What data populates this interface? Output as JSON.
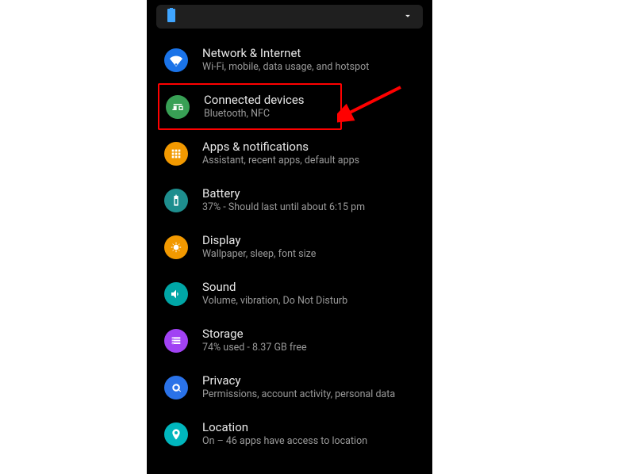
{
  "items": [
    {
      "title": "Network & Internet",
      "subtitle": "Wi-Fi, mobile, data usage, and hotspot"
    },
    {
      "title": "Connected devices",
      "subtitle": "Bluetooth, NFC"
    },
    {
      "title": "Apps & notifications",
      "subtitle": "Assistant, recent apps, default apps"
    },
    {
      "title": "Battery",
      "subtitle": "37% - Should last until about 6:15 pm"
    },
    {
      "title": "Display",
      "subtitle": "Wallpaper, sleep, font size"
    },
    {
      "title": "Sound",
      "subtitle": "Volume, vibration, Do Not Disturb"
    },
    {
      "title": "Storage",
      "subtitle": "74% used - 8.37 GB free"
    },
    {
      "title": "Privacy",
      "subtitle": "Permissions, account activity, personal data"
    },
    {
      "title": "Location",
      "subtitle": "On – 46 apps have access to location"
    }
  ],
  "colors": {
    "network": "#1a73e8",
    "connected": "#38a055",
    "apps": "#f29900",
    "battery": "#1e8e8e",
    "display": "#f29900",
    "sound": "#00a6a6",
    "storage": "#a142f4",
    "privacy": "#2a72e8",
    "location": "#00b6bd"
  },
  "highlightIndex": 1
}
